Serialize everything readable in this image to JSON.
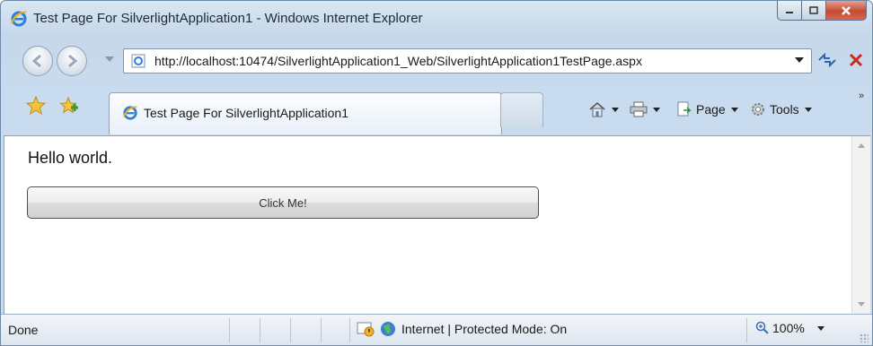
{
  "window": {
    "title": "Test Page For SilverlightApplication1 - Windows Internet Explorer"
  },
  "address_bar": {
    "url": "http://localhost:10474/SilverlightApplication1_Web/SilverlightApplication1TestPage.aspx"
  },
  "tabs": [
    {
      "label": "Test Page For SilverlightApplication1"
    }
  ],
  "command_bar": {
    "page_label": "Page",
    "tools_label": "Tools"
  },
  "content": {
    "heading": "Hello world.",
    "button_label": "Click Me!"
  },
  "status_bar": {
    "status": "Done",
    "zone": "Internet | Protected Mode: On",
    "zoom": "100%"
  }
}
